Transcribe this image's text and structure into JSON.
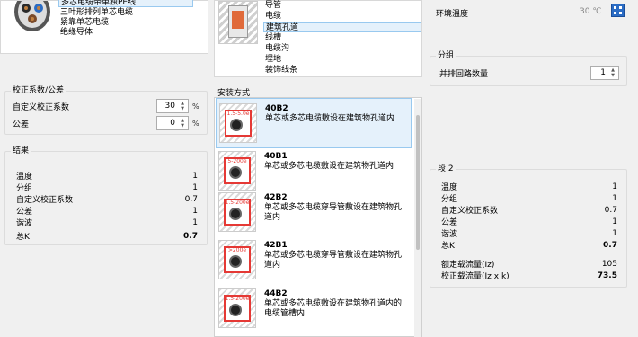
{
  "cable_types": {
    "items": [
      "多芯电缆带单独PE线",
      "三叶形排列单芯电缆",
      "紧靠单芯电缆",
      "绝缘导体"
    ],
    "selected_index": 0
  },
  "locations": {
    "items": [
      "导管",
      "电缆",
      "建筑孔道",
      "线槽",
      "电缆沟",
      "埋地",
      "装饰线条"
    ],
    "selected_index": 2
  },
  "ambient": {
    "label": "环境温度",
    "value": "30",
    "unit": "℃"
  },
  "grouping": {
    "title": "分组",
    "label": "并排回路数量",
    "value": "1"
  },
  "correction": {
    "title": "校正系数/公差",
    "custom_label": "自定义校正系数",
    "custom_value": "30",
    "custom_unit": "%",
    "tolerance_label": "公差",
    "tolerance_value": "0",
    "tolerance_unit": "%"
  },
  "results": {
    "title": "结果",
    "rows": [
      {
        "label": "温度",
        "value": "1"
      },
      {
        "label": "分组",
        "value": "1"
      },
      {
        "label": "自定义校正系数",
        "value": "0.7"
      },
      {
        "label": "公差",
        "value": "1"
      },
      {
        "label": "谐波",
        "value": "1"
      }
    ],
    "total_label": "总K",
    "total_value": "0.7"
  },
  "install": {
    "title": "安装方式",
    "methods": [
      {
        "code": "40B2",
        "desc": "单芯或多芯电缆敷设在建筑物孔道内",
        "dim": "1.5-5.0e"
      },
      {
        "code": "40B1",
        "desc": "单芯或多芯电缆敷设在建筑物孔道内",
        "dim": "5-200e"
      },
      {
        "code": "42B2",
        "desc": "单芯或多芯电缆穿导管敷设在建筑物孔道内",
        "dim": "1.5-200e"
      },
      {
        "code": "42B1",
        "desc": "单芯或多芯电缆穿导管敷设在建筑物孔道内",
        "dim": ">200e"
      },
      {
        "code": "44B2",
        "desc": "单芯或多芯电缆敷设在建筑物孔道内的电缆管槽内",
        "dim": "1.5-200e"
      }
    ],
    "selected_index": 0
  },
  "segment": {
    "title": "段 2",
    "rows": [
      {
        "label": "温度",
        "value": "1"
      },
      {
        "label": "分组",
        "value": "1"
      },
      {
        "label": "自定义校正系数",
        "value": "0.7"
      },
      {
        "label": "公差",
        "value": "1"
      },
      {
        "label": "谐波",
        "value": "1"
      }
    ],
    "total_label": "总K",
    "total_value": "0.7",
    "rated_label": "额定载流量(Iz)",
    "rated_value": "105",
    "corrected_label": "校正载流量(Iz x k)",
    "corrected_value": "73.5"
  },
  "colors": {
    "selection": "#e5f1fb",
    "accent_red": "#e53935",
    "icon_blue": "#2b6cc4"
  }
}
